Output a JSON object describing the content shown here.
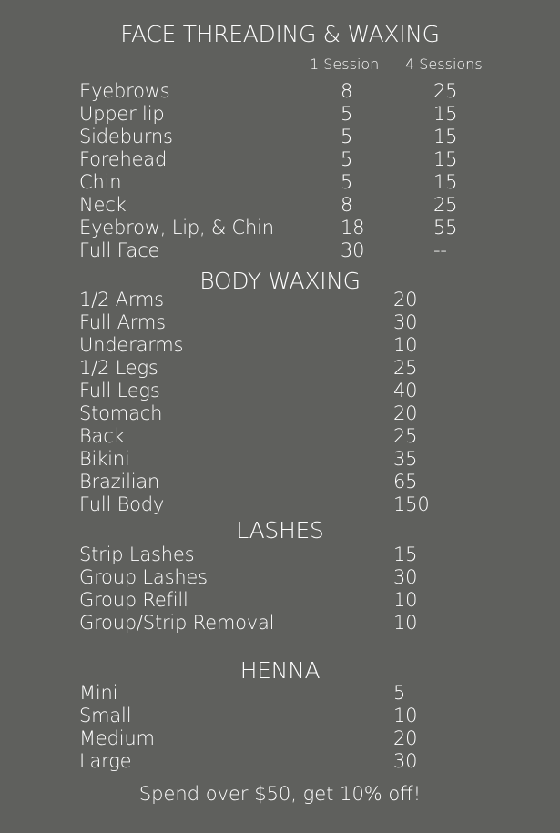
{
  "face": {
    "title": "FACE THREADING & WAXING",
    "col1": "1 Session",
    "col2": "4 Sessions",
    "items": [
      {
        "label": "Eyebrows",
        "one": "8",
        "four": "25"
      },
      {
        "label": "Upper lip",
        "one": "5",
        "four": "15"
      },
      {
        "label": "Sideburns",
        "one": "5",
        "four": "15"
      },
      {
        "label": "Forehead",
        "one": "5",
        "four": "15"
      },
      {
        "label": "Chin",
        "one": "5",
        "four": "15"
      },
      {
        "label": "Neck",
        "one": "8",
        "four": "25"
      },
      {
        "label": "Eyebrow, Lip, & Chin",
        "one": "18",
        "four": "55"
      },
      {
        "label": "Full Face",
        "one": "30",
        "four": "--"
      }
    ]
  },
  "body": {
    "title": "BODY WAXING",
    "items": [
      {
        "label": "1/2 Arms",
        "price": "20"
      },
      {
        "label": "Full Arms",
        "price": "30"
      },
      {
        "label": "Underarms",
        "price": "10"
      },
      {
        "label": "1/2 Legs",
        "price": "25"
      },
      {
        "label": "Full Legs",
        "price": "40"
      },
      {
        "label": "Stomach",
        "price": "20"
      },
      {
        "label": "Back",
        "price": "25"
      },
      {
        "label": "Bikini",
        "price": "35"
      },
      {
        "label": "Brazilian",
        "price": "65"
      },
      {
        "label": "Full Body",
        "price": "150"
      }
    ]
  },
  "lashes": {
    "title": "LASHES",
    "items": [
      {
        "label": "Strip Lashes",
        "price": "15"
      },
      {
        "label": "Group Lashes",
        "price": "30"
      },
      {
        "label": "Group Refill",
        "price": "10"
      },
      {
        "label": "Group/Strip Removal",
        "price": "10"
      }
    ]
  },
  "henna": {
    "title": "HENNA",
    "items": [
      {
        "label": "Mini",
        "price": "5"
      },
      {
        "label": "Small",
        "price": "10"
      },
      {
        "label": "Medium",
        "price": "20"
      },
      {
        "label": "Large",
        "price": "30"
      }
    ]
  },
  "footer": "Spend over $50, get 10% off!"
}
